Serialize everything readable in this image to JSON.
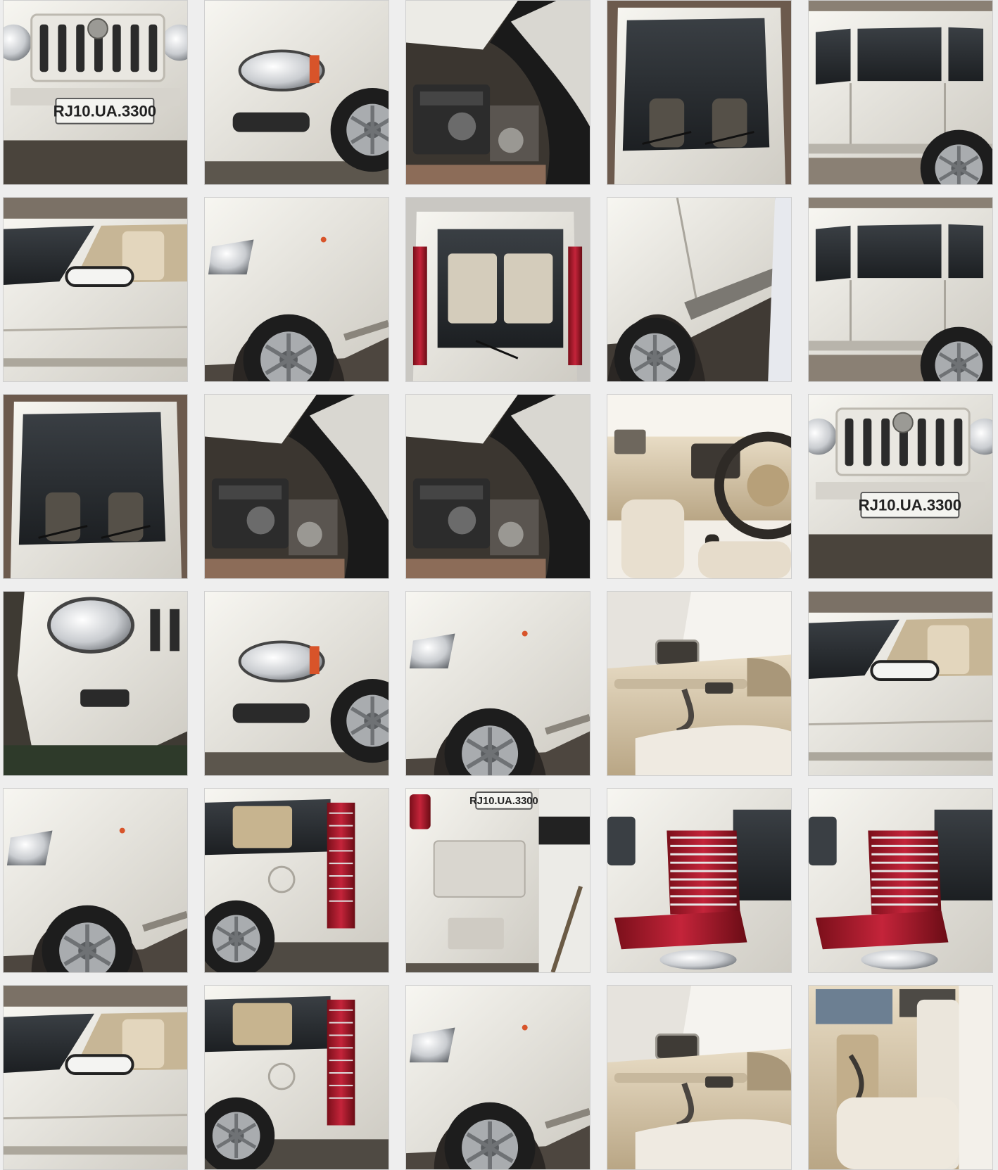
{
  "gallery": {
    "columns": 5,
    "photos": [
      {
        "view": "front-grille",
        "plate": "RJ10.UA.3300"
      },
      {
        "view": "headlight"
      },
      {
        "view": "engine"
      },
      {
        "view": "windshield"
      },
      {
        "view": "side-profile"
      },
      {
        "view": "side-mirror"
      },
      {
        "view": "fender-wheel"
      },
      {
        "view": "rear-window"
      },
      {
        "view": "side-step"
      },
      {
        "view": "side-profile"
      },
      {
        "view": "windshield"
      },
      {
        "view": "engine"
      },
      {
        "view": "engine"
      },
      {
        "view": "dashboard"
      },
      {
        "view": "front-grille",
        "plate": "RJ10.UA.3300"
      },
      {
        "view": "headlight-bumper"
      },
      {
        "view": "headlight"
      },
      {
        "view": "fender-wheel"
      },
      {
        "view": "door-interior"
      },
      {
        "view": "side-mirror"
      },
      {
        "view": "fender-wheel"
      },
      {
        "view": "tail-lamp-side"
      },
      {
        "view": "rear-bumper",
        "plate": "RJ10.UA.3300"
      },
      {
        "view": "tail-lamp"
      },
      {
        "view": "tail-lamp"
      },
      {
        "view": "side-mirror"
      },
      {
        "view": "tail-lamp-side"
      },
      {
        "view": "fender-wheel"
      },
      {
        "view": "door-interior"
      },
      {
        "view": "rear-seat"
      }
    ]
  }
}
